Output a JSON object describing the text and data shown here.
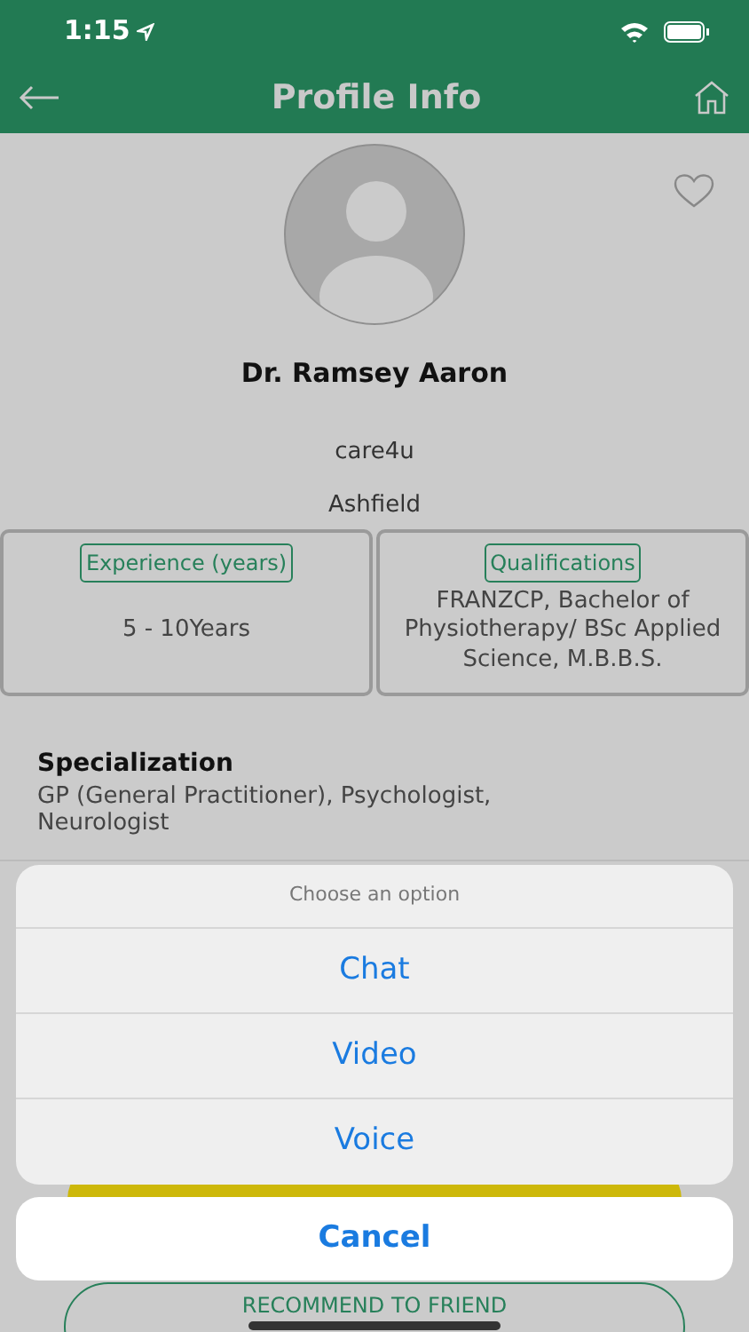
{
  "status_bar": {
    "time": "1:15"
  },
  "header": {
    "title": "Profile Info"
  },
  "profile": {
    "name": "Dr. Ramsey Aaron",
    "favorite": false,
    "clinic": "care4u",
    "location": "Ashfield"
  },
  "info_boxes": [
    {
      "label": "Experience (years)",
      "value": "5 - 10Years"
    },
    {
      "label": "Qualifications",
      "value": "FRANZCP, Bachelor of Physiotherapy/ BSc Applied Science, M.B.B.S."
    }
  ],
  "specialization": {
    "heading": "Specialization",
    "text": "GP (General Practitioner), Psychologist, Neurologist"
  },
  "action_sheet": {
    "title": "Choose an option",
    "options": [
      "Chat",
      "Video",
      "Voice"
    ],
    "cancel": "Cancel"
  },
  "recommend_button": "RECOMMEND TO FRIEND"
}
